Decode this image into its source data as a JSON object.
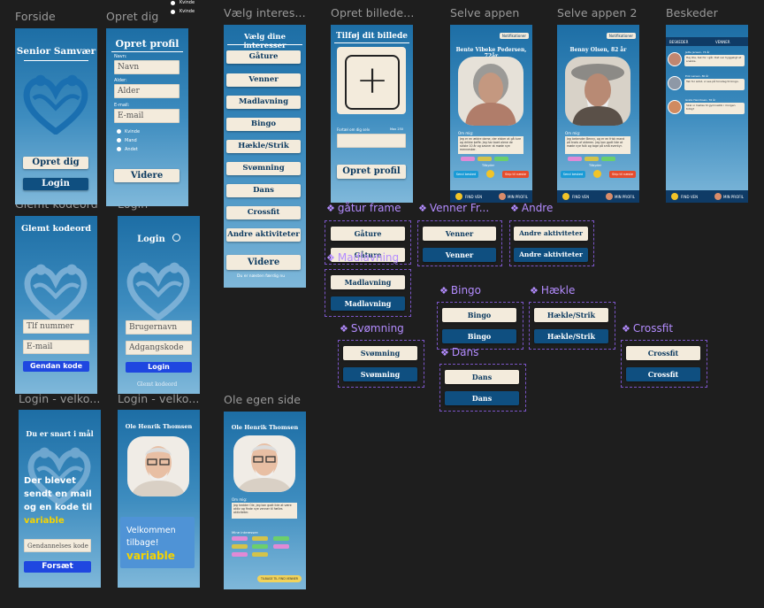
{
  "frame_labels": {
    "forside": "Forside",
    "opret_dig": "Opret dig",
    "vaelg_interesser": "Vælg interes...",
    "opret_billede": "Opret billede...",
    "selve_appen": "Selve appen",
    "selve_appen_2": "Selve appen 2",
    "beskeder": "Beskeder",
    "glemt_kodeord": "Glemt kodeord",
    "login": "Login",
    "login_velko_1": "Login - velko...",
    "login_velko_2": "Login - velko...",
    "ole_egen_side": "Ole egen side"
  },
  "top_radios": [
    "Kvinde",
    "Kvinde"
  ],
  "forside": {
    "title": "Senior Samvær",
    "opret_btn": "Opret dig",
    "login_btn": "Login"
  },
  "opret_profil": {
    "title": "Opret profil",
    "navn_label": "Navn:",
    "navn_placeholder": "Navn",
    "alder_label": "Alder:",
    "alder_placeholder": "Alder",
    "email_label": "E-mail:",
    "email_placeholder": "E-mail",
    "gender_options": [
      "Kvinde",
      "Mand",
      "Andet"
    ],
    "videre_btn": "Videre"
  },
  "interesser": {
    "title": "Vælg dine interesser",
    "items": [
      "Gåture",
      "Venner",
      "Madlavning",
      "Bingo",
      "Hækle/Strik",
      "Svømning",
      "Dans",
      "Crossfit",
      "Andre aktiviteter"
    ],
    "videre_btn": "Videre",
    "footer": "Du er næsten færdig nu"
  },
  "billede": {
    "title": "Tilføj dit billede",
    "plus": "+",
    "fortael_label": "Fortæl om dig selv",
    "fortael_hint": "Max 250",
    "opret_btn": "Opret profil"
  },
  "app1": {
    "badge": "Notifikationer",
    "name": "Bente Vibeke Pedersen, 72år",
    "om_label": "Om mig:",
    "om_text": "Jeg er en ældre dame, der elsker at gå ture og drikke kaffe. Jeg har boet alene de sidste 10 år og savner at møde nye mennesker.",
    "tilbyder": "Tilbyder",
    "btn_left": "Send besked",
    "btn_right": "Skip til næste",
    "nav_left": "FIND VEN",
    "nav_right": "MIN PROFIL"
  },
  "app2": {
    "badge": "Notifikationer",
    "name": "Benny Olsen, 82 år",
    "om_label": "Om mig:",
    "om_text": "Jeg bekender Benny, og er en frisk mand på trods af alderen. Jeg kan godt lide at møde nye folk og tage på små eventyr.",
    "tilbyder": "Tilbyder",
    "btn_left": "Send besked",
    "btn_right": "Skip til næste",
    "nav_left": "FIND VEN",
    "nav_right": "MIN PROFIL"
  },
  "beskeder": {
    "tab_left": "BESKEDER",
    "tab_right": "VENNER",
    "messages": [
      {
        "name": "Jette Jensen, 74 år",
        "text": "Hej Ole, tak for i går. Det var hyggeligt at snakke."
      },
      {
        "name": "Erik Larsen, 80 år",
        "text": "Tak for sidst, vi ses på torsdag til bingo."
      },
      {
        "name": "Greta Henriksen, 76 år",
        "text": "Skal vi mødes til gymnastik i morgen tidlig?"
      }
    ],
    "nav_left": "FIND VEN",
    "nav_right": "MIN PROFIL"
  },
  "glemt": {
    "title": "Glemt kodeord",
    "tlf_placeholder": "Tlf nummer",
    "email_placeholder": "E-mail",
    "btn": "Gendan kode"
  },
  "login": {
    "title": "Login",
    "bruger_placeholder": "Brugernavn",
    "kode_placeholder": "Adgangskode",
    "btn": "Login",
    "glemt_link": "Glemt kodeord"
  },
  "velko1": {
    "title": "Du er snart i mål",
    "msg_before": "Der blevet sendt en mail og en kode til",
    "msg_var": "variable",
    "code_placeholder": "Gendannelses kode",
    "btn": "Forsæt"
  },
  "velko2": {
    "name": "Ole Henrik Thomsen",
    "msg_before": "Velkommen tilbage!",
    "msg_var": "variable"
  },
  "ole": {
    "name": "Ole Henrik Thomsen",
    "om_label": "Om mig:",
    "om_text": "Jeg hedder Ole, jeg kan godt lide at være aktiv og finde nye venner til fælles aktiviteter.",
    "interesser_label": "Mine interesser:",
    "btn": "TILBAGE TIL FIND VENNER"
  },
  "components": {
    "gaature": {
      "label": "gåtur frame",
      "beige": "Gåture",
      "navy": "Gåture"
    },
    "venner": {
      "label": "Venner Fr...",
      "beige": "Venner",
      "navy": "Venner"
    },
    "andre": {
      "label": "Andre",
      "beige": "Andre aktiviteter",
      "navy": "Andre aktiviteter"
    },
    "madlavning": {
      "label": "Madlavning",
      "beige": "Madlavning",
      "navy": "Madlavning"
    },
    "bingo": {
      "label": "Bingo",
      "beige": "Bingo",
      "navy": "Bingo"
    },
    "haekle": {
      "label": "Hækle",
      "beige": "Hækle/Strik",
      "navy": "Hækle/Strik"
    },
    "svomning": {
      "label": "Svømning",
      "beige": "Svømning",
      "navy": "Svømning"
    },
    "dans": {
      "label": "Dans",
      "beige": "Dans",
      "navy": "Dans"
    },
    "crossfit": {
      "label": "Crossfit",
      "beige": "Crossfit",
      "navy": "Crossfit"
    }
  },
  "colors": {
    "canvas": "#1e1e1e",
    "frame_top": "#1d6ea5",
    "beige": "#f3ebdc",
    "navy": "#0f4f80",
    "accent_blue": "#1f47e0",
    "component_purple": "#b48cff",
    "variable_yellow": "#f5d300"
  }
}
